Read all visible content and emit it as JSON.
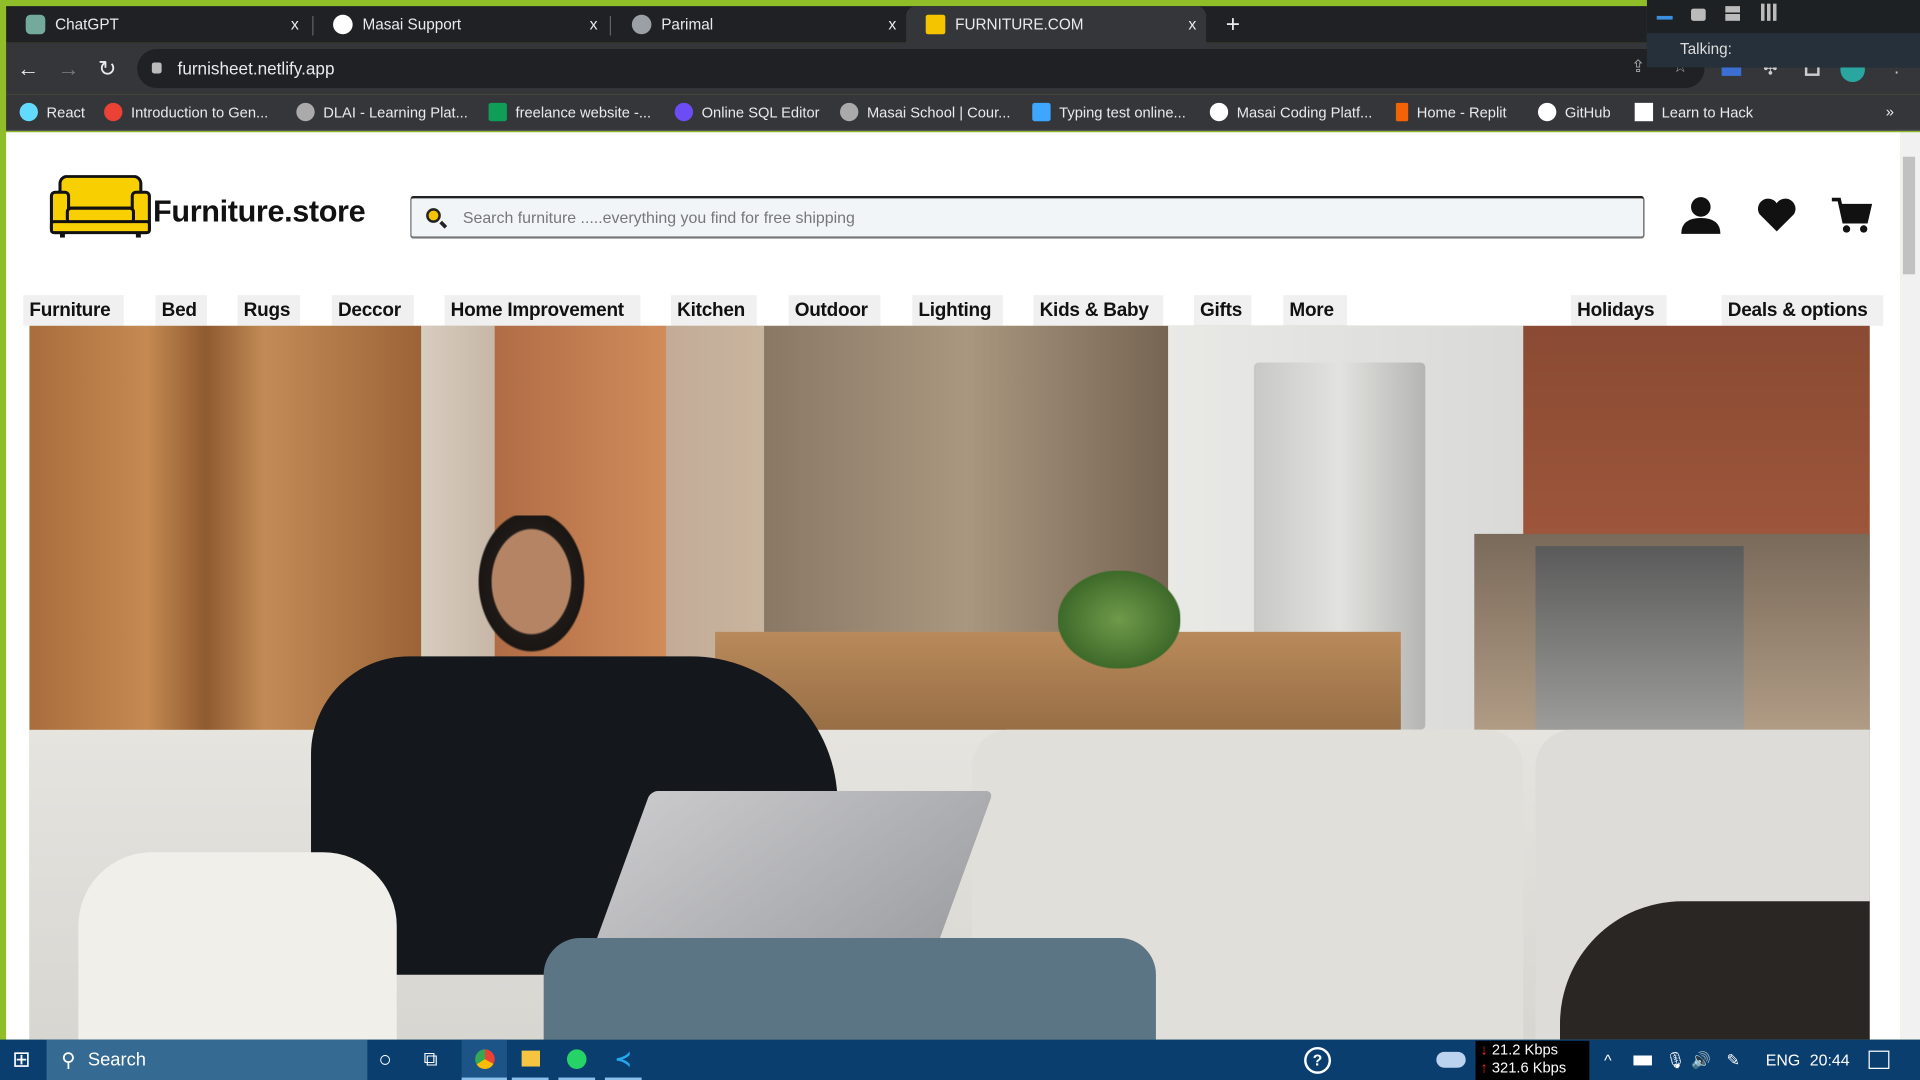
{
  "browser": {
    "tabs": [
      {
        "title": "ChatGPT",
        "icon": "chatgpt-icon",
        "color": "#74aa9c"
      },
      {
        "title": "Masai Support",
        "icon": "masai-icon",
        "color": "#ffffff"
      },
      {
        "title": "Parimal",
        "icon": "globe-icon",
        "color": "#9aa0a6"
      },
      {
        "title": "FURNITURE.COM",
        "icon": "sofa-favicon",
        "color": "#f5c400",
        "active": true
      }
    ],
    "new_tab": "+",
    "close": "x",
    "url": "furnisheet.netlify.app",
    "bookmarks": [
      {
        "label": "React",
        "color": "#61dafb"
      },
      {
        "label": "Introduction to Gen...",
        "color": "#ea4335"
      },
      {
        "label": "DLAI - Learning Plat...",
        "color": "#9aa0a6"
      },
      {
        "label": "freelance website -...",
        "color": "#0f9d58"
      },
      {
        "label": "Online SQL Editor",
        "color": "#6c4cf5"
      },
      {
        "label": "Masai School | Cour...",
        "color": "#9aa0a6"
      },
      {
        "label": "Typing test online...",
        "color": "#3ea6ff"
      },
      {
        "label": "Masai Coding Platf...",
        "color": "#ffffff"
      },
      {
        "label": "Home - Replit",
        "color": "#f26207"
      },
      {
        "label": "GitHub",
        "color": "#ffffff"
      },
      {
        "label": "Learn to Hack",
        "color": "#ffffff"
      }
    ],
    "more_bookmarks": "»"
  },
  "overlay": {
    "talking_label": "Talking:"
  },
  "site": {
    "logo_text": "Furniture.store",
    "search_placeholder": "Search furniture .....everything you find for free shipping",
    "nav": [
      "Furniture",
      "Bed",
      "Rugs",
      "Deccor",
      "Home Improvement",
      "Kitchen",
      "Outdoor",
      "Lighting",
      "Kids & Baby",
      "Gifts",
      "More",
      "Holidays",
      "Deals & options"
    ]
  },
  "taskbar": {
    "search": "Search",
    "net_down": "21.2 Kbps",
    "net_up": "321.6 Kbps",
    "lang": "ENG",
    "time": "20:44"
  }
}
